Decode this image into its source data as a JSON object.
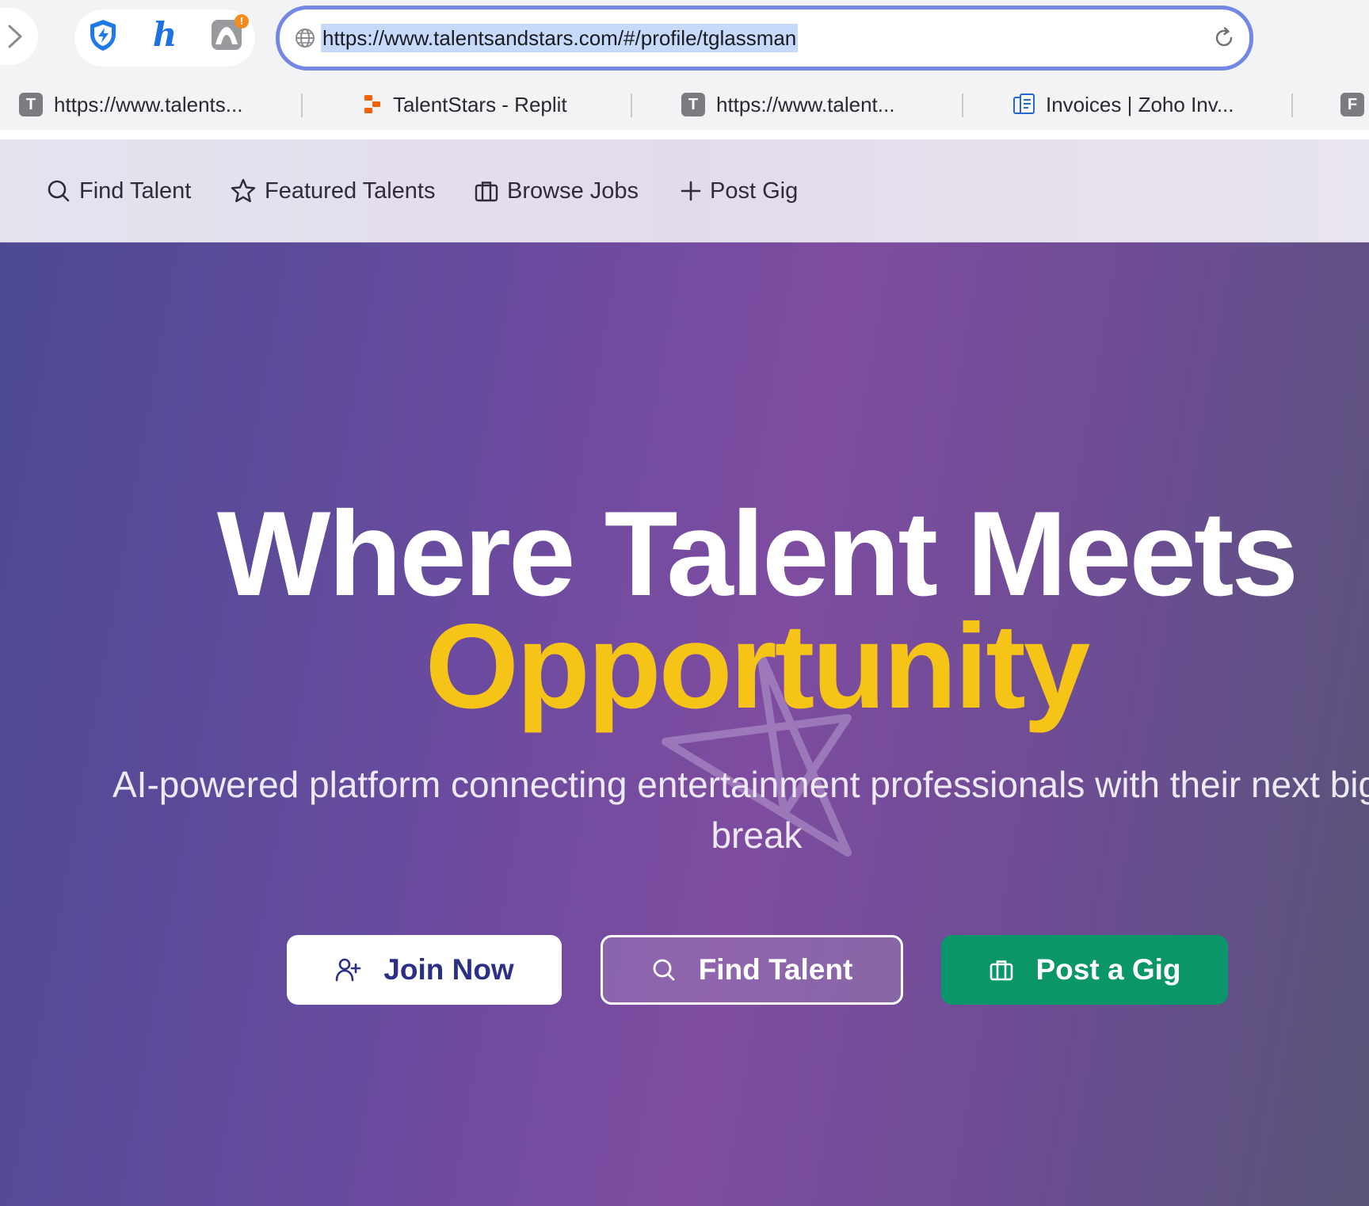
{
  "browser": {
    "url": "https://www.talentsandstars.com/#/profile/tglassman",
    "extensions": [
      "shield-extension",
      "honey-extension",
      "mountain-extension"
    ]
  },
  "tabs": [
    {
      "label": "https://www.talents...",
      "favicon": "T"
    },
    {
      "label": "TalentStars - Replit",
      "favicon": ""
    },
    {
      "label": "https://www.talent...",
      "favicon": "T"
    },
    {
      "label": "Invoices | Zoho Inv...",
      "favicon": ""
    },
    {
      "label": "",
      "favicon": "F"
    }
  ],
  "nav": {
    "find_talent": "Find Talent",
    "featured_talents": "Featured Talents",
    "browse_jobs": "Browse Jobs",
    "post_gig": "Post Gig"
  },
  "hero": {
    "title": "Where Talent Meets",
    "highlight": "Opportunity",
    "subtitle_line1": "AI-powered platform connecting entertainment professionals with their next big",
    "subtitle_line2": "break",
    "buttons": {
      "join": "Join Now",
      "find": "Find Talent",
      "post": "Post a Gig"
    }
  },
  "colors": {
    "accent_yellow": "#f6c417",
    "join_text": "#2c2f86",
    "post_green": "#0b9669",
    "urlbar_border": "#7387e6"
  }
}
